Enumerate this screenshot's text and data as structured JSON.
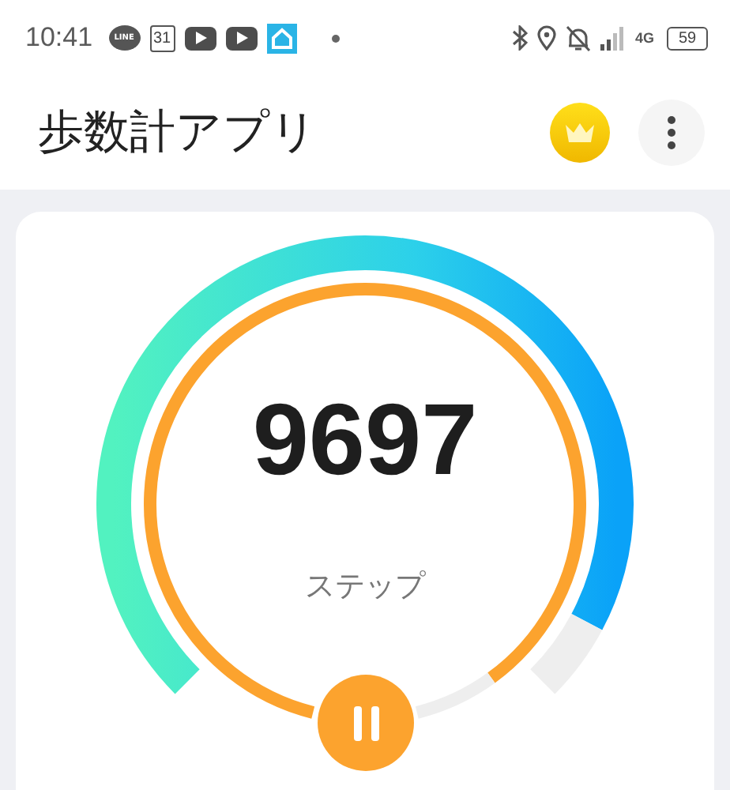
{
  "status_bar": {
    "time": "10:41",
    "line_logo": "LINE",
    "calendar_day": "31",
    "network": "4G",
    "battery": "59"
  },
  "header": {
    "title": "歩数計アプリ"
  },
  "gauge": {
    "steps": "9697",
    "unit": "ステップ"
  },
  "ring": {
    "paused": false
  }
}
